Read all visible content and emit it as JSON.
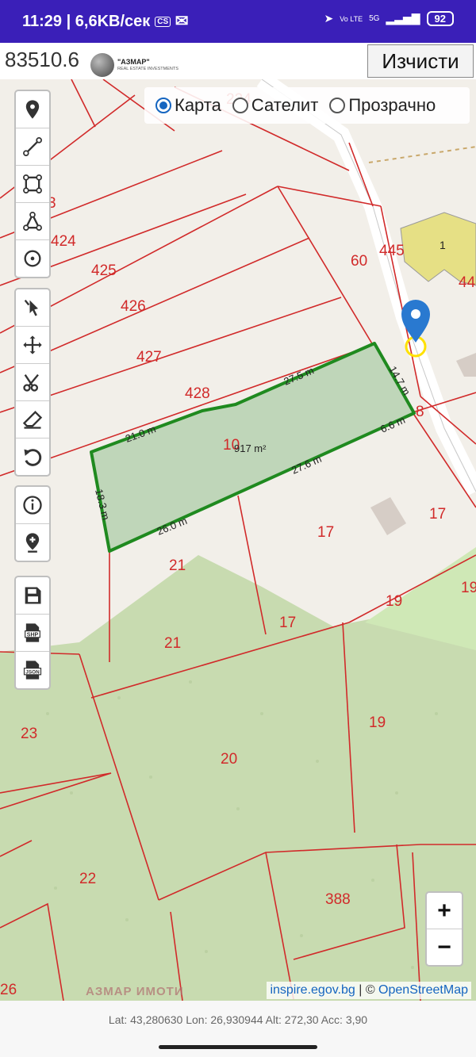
{
  "status_bar": {
    "time": "11:29",
    "speed": "| 6,6KB/сек",
    "cs_badge": "CS",
    "network": "5G",
    "volte": "Vo LTE",
    "battery": "92"
  },
  "header": {
    "parcel_id": "83510.6",
    "logo_title": "\"АЗМАР\"",
    "logo_subtitle": "REAL ESTATE INVESTMENTS",
    "clear_label": "Изчисти"
  },
  "layers": {
    "options": [
      "Карта",
      "Сателит",
      "Прозрачно"
    ],
    "selected": "Карта"
  },
  "tools": {
    "draw": [
      "marker-icon",
      "polyline-icon",
      "rectangle-icon",
      "polygon-icon",
      "circle-icon"
    ],
    "edit": [
      "select-cursor-icon",
      "move-icon",
      "scissors-icon",
      "eraser-icon",
      "undo-icon"
    ],
    "info": [
      "info-icon",
      "location-add-icon"
    ],
    "export": [
      "save-icon",
      "shp-icon",
      "json-icon"
    ]
  },
  "map": {
    "parcel_numbers": [
      "424",
      "425",
      "426",
      "427",
      "428",
      "10",
      "60",
      "445",
      "1",
      "44",
      "8",
      "17",
      "17",
      "19",
      "19",
      "21",
      "21",
      "17",
      "23",
      "20",
      "19",
      "22",
      "388",
      "26",
      "224",
      "3"
    ],
    "area_label": "917 m²",
    "segments": [
      "21.0 m",
      "27.5 m",
      "14.7 m",
      "6.6 m",
      "27.6 m",
      "26.0 m",
      "18.3 m"
    ],
    "watermark": "АЗМАР ИМОТИ",
    "colors": {
      "selection": "#1f8a1f",
      "parcel_line": "#d12a2a",
      "forest": "#c8dbb0",
      "marker": "#2979d0"
    }
  },
  "zoom": {
    "in": "+",
    "out": "−"
  },
  "attribution": {
    "source": "inspire.egov.bg",
    "separator": " | © ",
    "osm": "OpenStreetMap"
  },
  "footer": {
    "coords": "Lat: 43,280630 Lon: 26,930944 Alt: 272,30 Acc: 3,90"
  }
}
